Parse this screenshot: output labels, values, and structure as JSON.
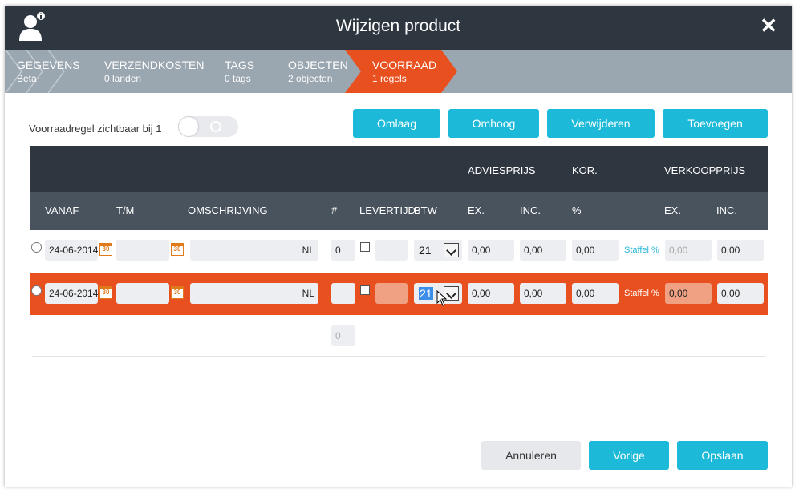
{
  "title": "Wijzigen product",
  "icons": {
    "user": "user-info-icon",
    "close": "close-icon"
  },
  "colors": {
    "accent": "#1cb9d8",
    "active_step": "#e9501f",
    "header_dark": "#2e3640"
  },
  "steps": [
    {
      "name": "GEGEVENS",
      "sub": "Beta"
    },
    {
      "name": "VERZENDKOSTEN",
      "sub": "0 landen"
    },
    {
      "name": "TAGS",
      "sub": "0 tags"
    },
    {
      "name": "OBJECTEN",
      "sub": "2 objecten"
    },
    {
      "name": "VOORRAAD",
      "sub": "1 regels"
    }
  ],
  "toolbar": {
    "visible_label": "Voorraadregel zichtbaar bij 1",
    "buttons": {
      "down": "Omlaag",
      "up": "Omhoog",
      "delete": "Verwijderen",
      "add": "Toevoegen"
    }
  },
  "table": {
    "group_headers": {
      "advice": "ADVIESPRIJS",
      "discount": "KOR.",
      "sale": "VERKOOPPRIJS"
    },
    "columns": {
      "from": "VANAF",
      "to": "T/M",
      "desc": "OMSCHRIJVING",
      "count": "#",
      "delivery": "LEVERTIJD",
      "vat": "BTW",
      "ex": "EX.",
      "inc": "INC.",
      "pct": "%",
      "sale_ex": "EX.",
      "sale_inc": "INC."
    },
    "rows": [
      {
        "from": "24-06-2014",
        "cal_day": "30",
        "to": "",
        "to_cal_day": "30",
        "desc_lang": "NL",
        "count": "0",
        "delivery": "",
        "vat": "21",
        "adv_ex": "0,00",
        "adv_inc": "0,00",
        "discount": "0,00",
        "staffel": "Staffel %",
        "sale_ex": "0,00",
        "sale_inc": "0,00"
      },
      {
        "from": "24-06-2014",
        "cal_day": "30",
        "to": "",
        "to_cal_day": "30",
        "desc_lang": "NL",
        "count": "",
        "delivery": "",
        "vat": "21",
        "adv_ex": "0,00",
        "adv_inc": "0,00",
        "discount": "0,00",
        "staffel": "Staffel %",
        "sale_ex": "0,00",
        "sale_inc": "0,00"
      }
    ],
    "total_count": "0"
  },
  "footer": {
    "cancel": "Annuleren",
    "previous": "Vorige",
    "save": "Opslaan"
  }
}
